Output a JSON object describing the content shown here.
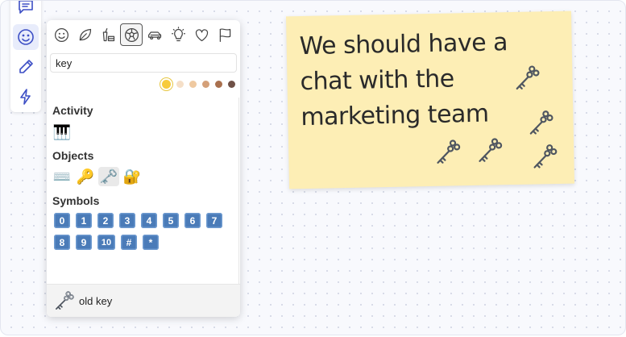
{
  "toolbar": {
    "items": [
      {
        "name": "comment-icon"
      },
      {
        "name": "emoji-icon",
        "active": true
      },
      {
        "name": "pen-icon"
      },
      {
        "name": "lightning-icon"
      }
    ]
  },
  "picker": {
    "categories": [
      "smileys-icon",
      "nature-icon",
      "food-icon",
      "activity-icon",
      "travel-icon",
      "objects-icon",
      "symbols-icon",
      "flags-icon"
    ],
    "search": {
      "value": "key"
    },
    "skin_tones": [
      "#f7cb3c",
      "#f5dfc8",
      "#efc9a0",
      "#d4a079",
      "#a9704e",
      "#6f5147"
    ],
    "sections": [
      {
        "title": "Activity",
        "emojis": [
          "🎹"
        ]
      },
      {
        "title": "Objects",
        "emojis": [
          "⌨️",
          "🔑",
          "🗝️",
          "🔐"
        ]
      },
      {
        "title": "Symbols",
        "row1": [
          "0",
          "1",
          "2",
          "3",
          "4",
          "5",
          "6",
          "7"
        ],
        "row2": [
          "8",
          "9",
          "10",
          "#",
          "*"
        ]
      }
    ],
    "preview": {
      "name": "old key"
    }
  },
  "note": {
    "text": "We should have a chat with the marketing team",
    "background": "#fdeeb5"
  },
  "accent": "#3d4fc5"
}
